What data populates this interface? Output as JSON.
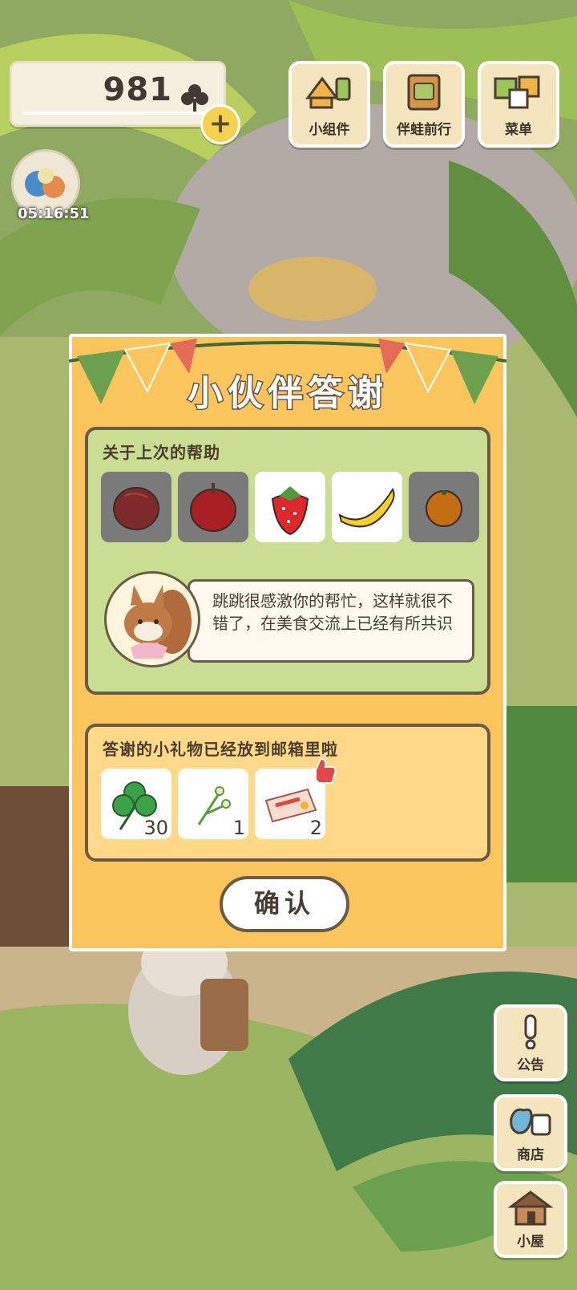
{
  "hud": {
    "clover_count": "981",
    "timer": "05:16:51"
  },
  "top_buttons": [
    {
      "label": "小组件",
      "icon": "widget-icon"
    },
    {
      "label": "伴蛙前行",
      "icon": "travel-book-icon"
    },
    {
      "label": "菜单",
      "icon": "menu-cards-icon"
    }
  ],
  "side_buttons": [
    {
      "label": "公告",
      "icon": "exclamation-icon"
    },
    {
      "label": "商店",
      "icon": "shop-bags-icon"
    },
    {
      "label": "小屋",
      "icon": "house-icon"
    }
  ],
  "dialog": {
    "title": "小伙伴答谢",
    "help_heading": "关于上次的帮助",
    "fruits": [
      {
        "icon": "peach-icon",
        "highlighted": false
      },
      {
        "icon": "apple-icon",
        "highlighted": false
      },
      {
        "icon": "strawberry-icon",
        "highlighted": true
      },
      {
        "icon": "banana-icon",
        "highlighted": true
      },
      {
        "icon": "orange-icon",
        "highlighted": false
      }
    ],
    "message": "跳跳很感激你的帮忙，这样就很不错了，在美食交流上已经有所共识",
    "gift_heading": "答谢的小礼物已经放到邮箱里啦",
    "gifts": [
      {
        "icon": "clover-icon",
        "qty": "30"
      },
      {
        "icon": "flower-sprig-icon",
        "qty": "1"
      },
      {
        "icon": "ticket-icon",
        "qty": "2"
      }
    ],
    "confirm_label": "确认"
  },
  "colors": {
    "dialog_bg": "#fbc55e",
    "panel_green": "#c9dd93",
    "panel_yellow": "#ffd987",
    "outline": "#6b5a46"
  }
}
